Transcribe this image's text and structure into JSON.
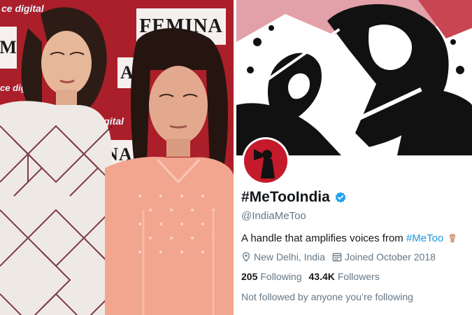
{
  "photo": {
    "backdrop_brand": "FEMINA",
    "backdrop_brand_partial": "NA",
    "backdrop_sponsor": "Reliance Digital",
    "backdrop_sponsor_partial": "ance digital",
    "backdrop_side_partial": "ce digital",
    "backdrop_letters": [
      "M",
      "A",
      "A"
    ],
    "colors": {
      "backdrop_red": "#b8202a",
      "tile": "#f5f0ee"
    }
  },
  "profile": {
    "display_name": "#MeTooIndia",
    "verified_icon": "verified-badge-icon",
    "handle": "@IndiaMeToo",
    "bio_text": "A handle that amplifies voices from ",
    "bio_hashtag": "#MeToo",
    "bio_emoji": "raised-fist-icon",
    "location": "New Delhi, India",
    "location_icon": "location-pin-icon",
    "joined": "Joined October 2018",
    "joined_icon": "calendar-icon",
    "following_count": "205",
    "following_label": "Following",
    "followers_count": "43.4K",
    "followers_label": "Followers",
    "followed_note": "Not followed by anyone you’re following",
    "colors": {
      "link": "#1b95e0",
      "muted": "#657786",
      "text": "#14171a",
      "avatar_bg": "#c41a2b"
    }
  }
}
